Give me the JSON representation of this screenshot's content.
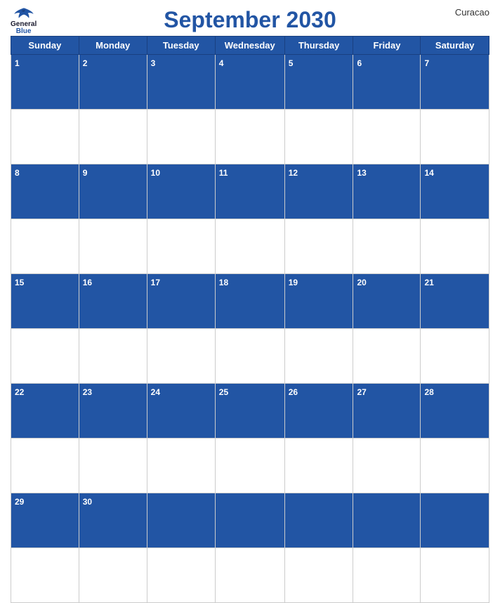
{
  "header": {
    "logo_general": "General",
    "logo_blue": "Blue",
    "title": "September 2030",
    "country": "Curacao"
  },
  "days_of_week": [
    "Sunday",
    "Monday",
    "Tuesday",
    "Wednesday",
    "Thursday",
    "Friday",
    "Saturday"
  ],
  "weeks": [
    {
      "numbers": [
        1,
        2,
        3,
        4,
        5,
        6,
        7
      ],
      "has_empty_before": false
    },
    {
      "numbers": [
        8,
        9,
        10,
        11,
        12,
        13,
        14
      ],
      "has_empty_before": false
    },
    {
      "numbers": [
        15,
        16,
        17,
        18,
        19,
        20,
        21
      ],
      "has_empty_before": false
    },
    {
      "numbers": [
        22,
        23,
        24,
        25,
        26,
        27,
        28
      ],
      "has_empty_before": false
    },
    {
      "numbers": [
        29,
        30,
        null,
        null,
        null,
        null,
        null
      ],
      "has_empty_before": false
    }
  ]
}
